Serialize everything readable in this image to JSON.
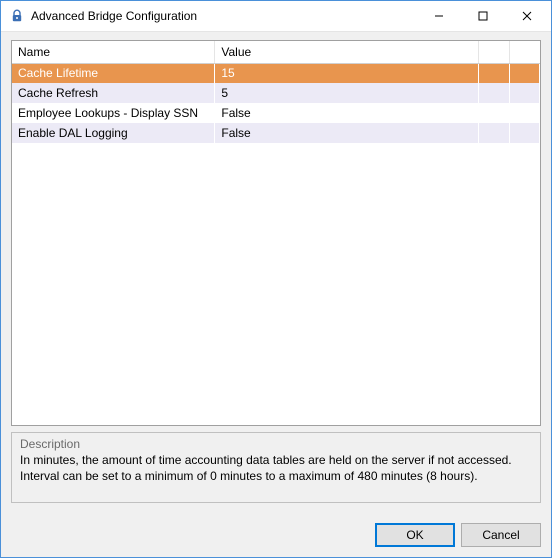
{
  "window": {
    "title": "Advanced Bridge Configuration"
  },
  "grid": {
    "headers": {
      "name": "Name",
      "value": "Value"
    },
    "col_widths": {
      "name": 200,
      "value": 260,
      "spacer1": 30,
      "spacer2": 30
    },
    "rows": [
      {
        "name": "Cache Lifetime",
        "value": "15",
        "state": "selected"
      },
      {
        "name": "Cache Refresh",
        "value": "5",
        "state": "alt"
      },
      {
        "name": "Employee Lookups - Display SSN",
        "value": "False",
        "state": "normal"
      },
      {
        "name": "Enable DAL Logging",
        "value": "False",
        "state": "alt"
      }
    ]
  },
  "description": {
    "heading": "Description",
    "body_line1": "In minutes, the amount of time accounting data tables are held on the server if not accessed.",
    "body_line2": "Interval can be set to a minimum of 0 minutes to a maximum of 480 minutes (8 hours)."
  },
  "buttons": {
    "ok": "OK",
    "cancel": "Cancel"
  }
}
